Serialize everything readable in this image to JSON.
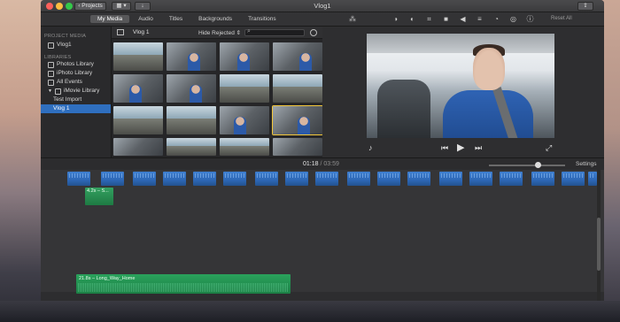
{
  "window": {
    "title": "Vlog1"
  },
  "toolbar": {
    "projects_label": "Projects",
    "tabs": [
      {
        "label": "My Media",
        "active": true
      },
      {
        "label": "Audio"
      },
      {
        "label": "Titles"
      },
      {
        "label": "Backgrounds"
      },
      {
        "label": "Transitions"
      }
    ],
    "adjust_tools": [
      "color-balance-icon",
      "color-correction-icon",
      "crop-icon",
      "stabilization-icon",
      "volume-icon",
      "equalizer-icon",
      "speed-icon",
      "filter-icon",
      "info-icon"
    ],
    "reset_all": "Reset All"
  },
  "sidebar": {
    "project_media_header": "PROJECT MEDIA",
    "project_item": "Vlog1",
    "libraries_header": "LIBRARIES",
    "items": [
      {
        "label": "Photos Library"
      },
      {
        "label": "iPhoto Library"
      },
      {
        "label": "All Events"
      },
      {
        "label": "iMovie Library"
      }
    ],
    "events": [
      {
        "label": "Test Import",
        "selected": false
      },
      {
        "label": "Vlog 1",
        "selected": true
      }
    ]
  },
  "browser": {
    "event_name": "Vlog 1",
    "filter_label": "Hide Rejected",
    "search_placeholder": ""
  },
  "timeline": {
    "timecode_current": "01:18",
    "timecode_total": "/ 03:59",
    "settings_label": "Settings",
    "zoom_level": 0.62,
    "audio_clip_label": "4.2s – S...",
    "music_clip_label": "21.8s – Long_Way_Home"
  },
  "colors": {
    "accent": "#2f6fbf",
    "video_clip": "#2d67b5",
    "audio_clip": "#1e7a43"
  }
}
